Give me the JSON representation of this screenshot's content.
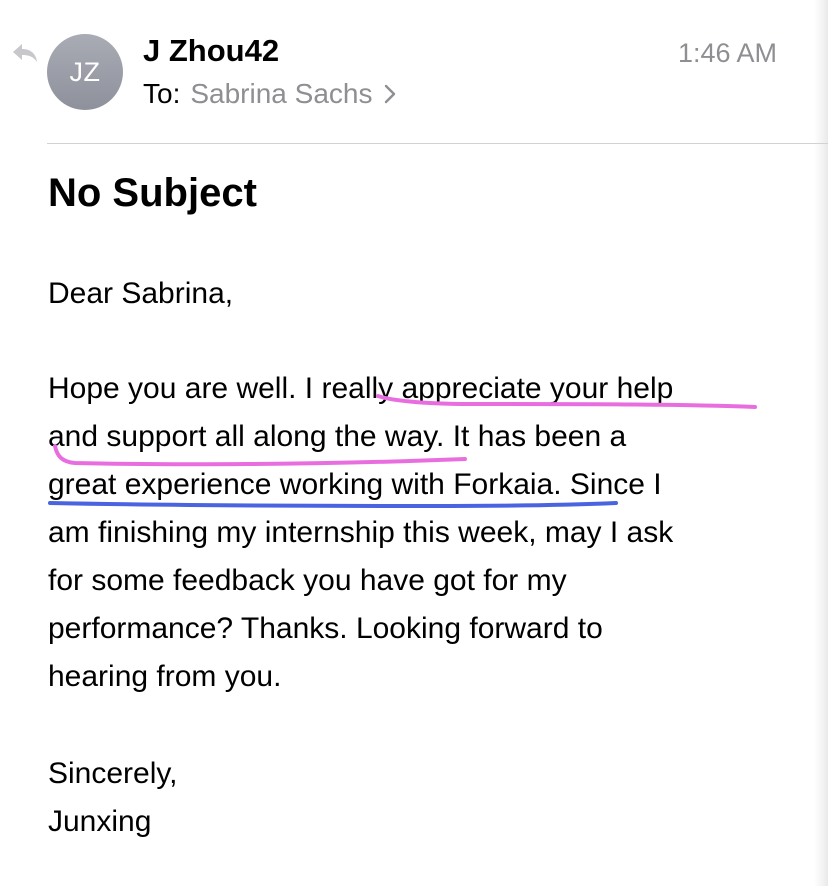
{
  "header": {
    "avatar_initials": "JZ",
    "sender_name": "J Zhou42",
    "to_label": "To:",
    "recipient": "Sabrina Sachs",
    "time": "1:46 AM"
  },
  "message": {
    "subject": "No Subject",
    "greeting": "Dear Sabrina,",
    "body_lines": [
      "Hope you are well. I really appreciate your help",
      "and support all along the way. It has been a",
      "great experience working with Forkaia. Since I",
      "am finishing my internship this week, may I ask",
      "for some feedback you have got for my",
      "performance? Thanks. Looking forward to",
      "hearing from you."
    ],
    "signoff": "Sincerely,",
    "signature": "Junxing"
  },
  "annotations": {
    "pink_underline_color": "#e86ee0",
    "blue_underline_color": "#4a63e0"
  },
  "icons": {
    "reply": "reply-arrow-icon",
    "disclosure": "chevron-right-icon"
  }
}
